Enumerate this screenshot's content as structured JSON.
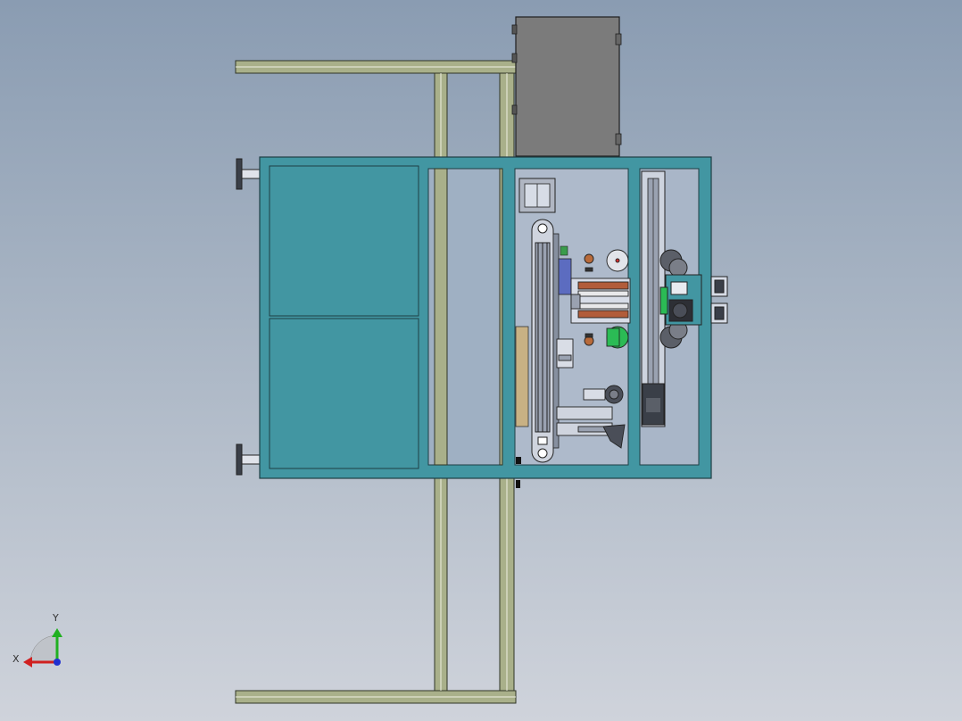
{
  "viewport": {
    "background_top": "#8a9cb2",
    "background_bottom": "#cfd3db"
  },
  "colors": {
    "frame_rail": "#a9b08a",
    "frame_edge": "#2f3526",
    "panel_teal": "#4296a2",
    "panel_teal_edge": "#1f3e44",
    "cabinet_gray": "#7b7b7b",
    "module_blue": "#cfd7ea",
    "accent_green": "#2bbb55",
    "accent_red": "#d03030",
    "accent_tan": "#c8b184"
  },
  "triad": {
    "x_label": "X",
    "y_label": "Y",
    "x_color": "#d02020",
    "y_color": "#20b020",
    "z_color": "#2030d0",
    "icon": "coordinate-triad-icon"
  }
}
